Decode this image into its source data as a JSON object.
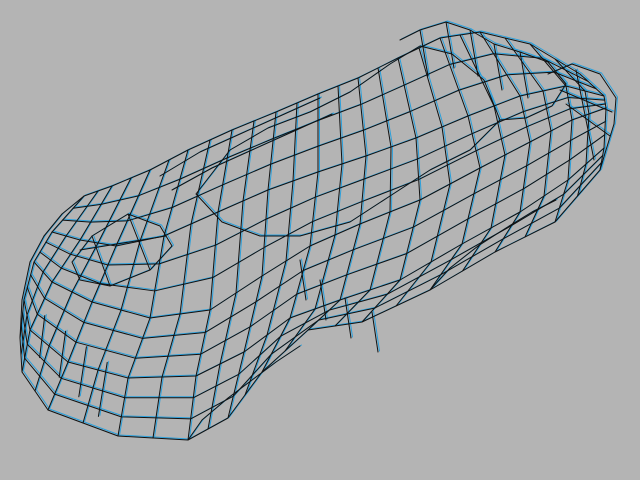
{
  "viewport": {
    "background_color": "#b4b4b4",
    "wire_color": "#111111",
    "selection_color": "#2aa0dc"
  },
  "model": {
    "kind": "car-body-wireframe"
  }
}
